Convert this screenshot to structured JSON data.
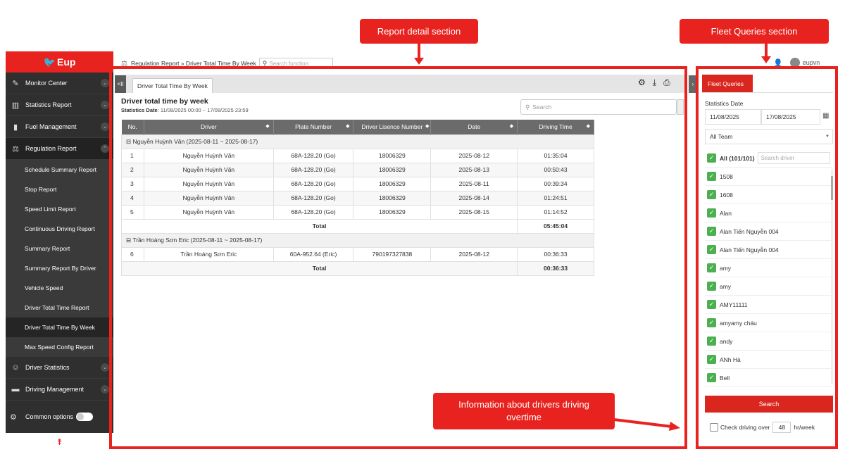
{
  "annotations": {
    "report_detail": "Report detail section",
    "fleet_queries": "Fleet Queries section",
    "overtime_info": "Information about drivers driving overtime"
  },
  "sidebar": {
    "logo": "Eup",
    "items": [
      {
        "label": "Monitor Center",
        "icon": "monitor-icon"
      },
      {
        "label": "Statistics Report",
        "icon": "chart-icon"
      },
      {
        "label": "Fuel Management",
        "icon": "fuel-icon"
      },
      {
        "label": "Regulation Report",
        "icon": "gavel-icon"
      }
    ],
    "sub_items": [
      "Schedule Summary Report",
      "Stop Report",
      "Speed Limit Report",
      "Continuous Driving Report",
      "Summary Report",
      "Summary Report By Driver",
      "Vehicle Speed",
      "Driver Total Time Report",
      "Driver Total Time By Week",
      "Max Speed Config Report"
    ],
    "items_after": [
      {
        "label": "Driver Statistics",
        "icon": "driver-stats-icon"
      },
      {
        "label": "Driving Management",
        "icon": "driving-mgmt-icon"
      }
    ],
    "common_options": "Common options"
  },
  "breadcrumb": {
    "text": "Regulation Report » Driver Total Time By Week",
    "search_placeholder": "Search function"
  },
  "user": {
    "name": "eupvn"
  },
  "report": {
    "tab": "Driver Total Time By Week",
    "title": "Driver total time by week",
    "subtitle_label": "Statistics Date",
    "subtitle_value": ": 11/08/2025 00:00 ~ 17/08/2025 23:59",
    "search_placeholder": "Search",
    "columns": [
      "No.",
      "Driver",
      "Plate Number",
      "Driver Lisence Number",
      "Date",
      "Driving Time"
    ],
    "groups": [
      {
        "header": "⊟ Nguyễn Huỳnh Văn (2025-08-11 ~ 2025-08-17)",
        "rows": [
          [
            "1",
            "Nguyễn Huỳnh Văn",
            "68A-128.20 (Go)",
            "18006329",
            "2025-08-12",
            "01:35:04"
          ],
          [
            "2",
            "Nguyễn Huỳnh Văn",
            "68A-128.20 (Go)",
            "18006329",
            "2025-08-13",
            "00:50:43"
          ],
          [
            "3",
            "Nguyễn Huỳnh Văn",
            "68A-128.20 (Go)",
            "18006329",
            "2025-08-11",
            "00:39:34"
          ],
          [
            "4",
            "Nguyễn Huỳnh Văn",
            "68A-128.20 (Go)",
            "18006329",
            "2025-08-14",
            "01:24:51"
          ],
          [
            "5",
            "Nguyễn Huỳnh Văn",
            "68A-128.20 (Go)",
            "18006329",
            "2025-08-15",
            "01:14:52"
          ]
        ],
        "total_label": "Total",
        "total": "05:45:04"
      },
      {
        "header": "⊟ Trần Hoàng Sơn Eric (2025-08-11 ~ 2025-08-17)",
        "rows": [
          [
            "6",
            "Trần Hoàng Sơn Eric",
            "60A-952.64 (Eric)",
            "790197327838",
            "2025-08-12",
            "00:36:33"
          ]
        ],
        "total_label": "Total",
        "total": "00:36:33"
      }
    ]
  },
  "fleet": {
    "tab": "Fleet Queries",
    "date_label": "Statistics Date",
    "date_from": "11/08/2025",
    "date_to": "17/08/2025",
    "team": "All Team",
    "all_label": "All (101/101)",
    "driver_search_placeholder": "Search driver",
    "drivers": [
      "1508",
      "1608",
      "Alan",
      "Alan Tiến Nguyễn 004",
      "Alan Tiến Nguyễn 004",
      "amy",
      "amy",
      "AMY11111",
      "amyamy cháu",
      "andy",
      "ANh Hà",
      "Bell"
    ],
    "search_button": "Search",
    "overtime_label": "Check driving over",
    "overtime_value": "48",
    "overtime_unit": "hr/week"
  }
}
